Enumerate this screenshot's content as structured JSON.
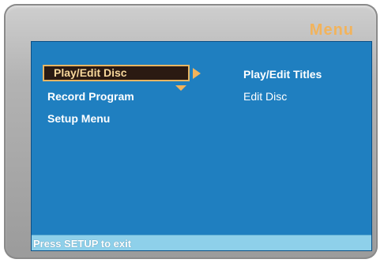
{
  "window": {
    "title": "Menu"
  },
  "menu": {
    "items": [
      {
        "label": "Play/Edit Disc",
        "selected": true
      },
      {
        "label": "Record Program"
      },
      {
        "label": "Setup Menu"
      }
    ]
  },
  "submenu": {
    "items": [
      {
        "label": "Play/Edit Titles",
        "emphasized": true
      },
      {
        "label": "Edit Disc"
      }
    ]
  },
  "footer": {
    "hint": "Press SETUP to exit"
  },
  "colors": {
    "screen_background": "#1f7fc0",
    "accent": "#f2b35b",
    "footer_bar": "#8ed0ea"
  },
  "icons": {
    "selection_right": "arrow-right-icon",
    "selection_down": "arrow-down-icon"
  }
}
